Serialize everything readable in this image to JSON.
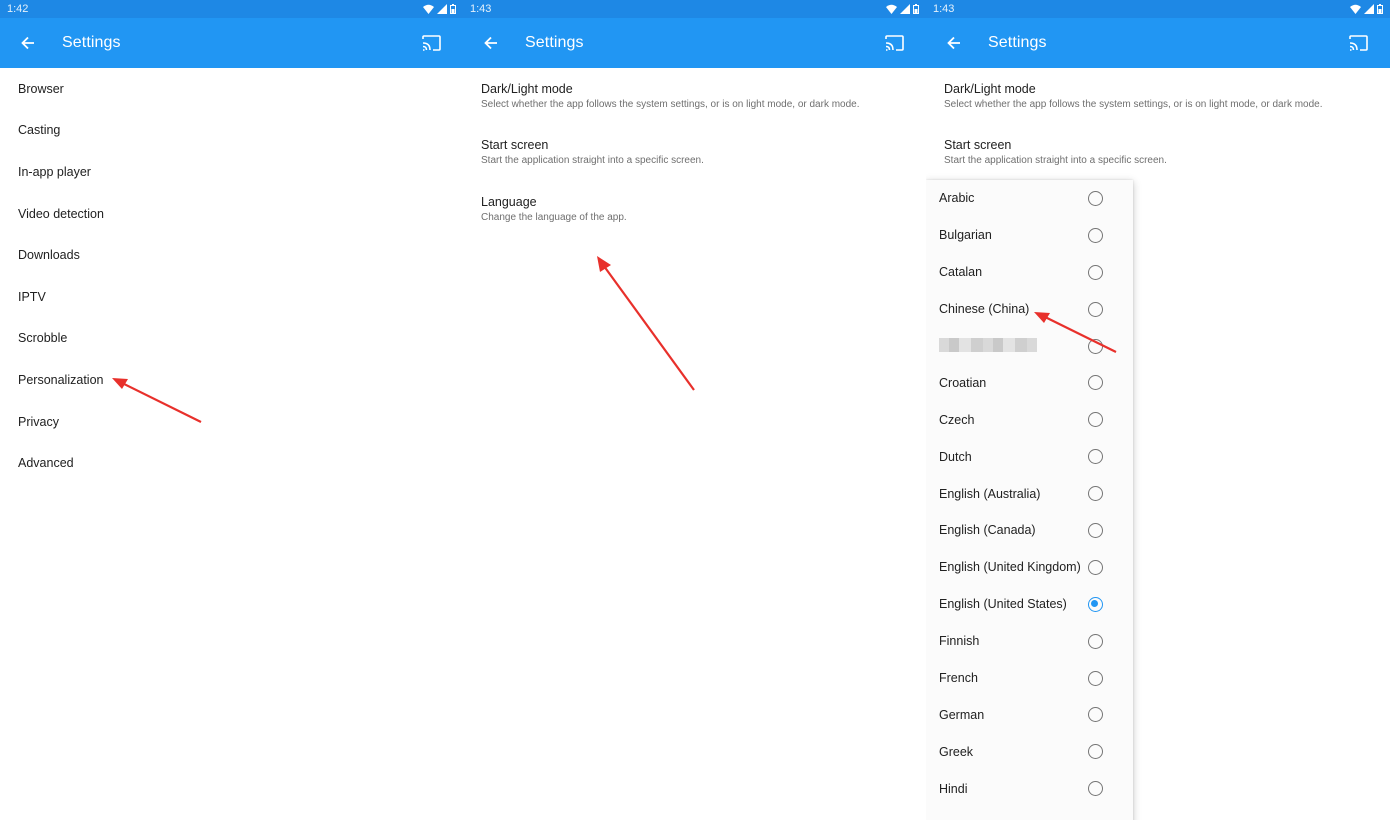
{
  "colors": {
    "status_bar": "#1e88e5",
    "app_bar": "#2196f3",
    "accent": "#2196f3",
    "annotation_arrow": "#e8302b"
  },
  "panels": [
    {
      "status_time": "1:42",
      "title": "Settings",
      "menu_items": [
        "Browser",
        "Casting",
        "In-app player",
        "Video detection",
        "Downloads",
        "IPTV",
        "Scrobble",
        "Personalization",
        "Privacy",
        "Advanced"
      ]
    },
    {
      "status_time": "1:43",
      "title": "Settings",
      "prefs": [
        {
          "title": "Dark/Light mode",
          "summary": "Select whether the app follows the system settings, or is on light mode, or dark mode."
        },
        {
          "title": "Start screen",
          "summary": "Start the application straight into a specific screen."
        },
        {
          "title": "Language",
          "summary": "Change the language of the app."
        }
      ]
    },
    {
      "status_time": "1:43",
      "title": "Settings",
      "prefs": [
        {
          "title": "Dark/Light mode",
          "summary": "Select whether the app follows the system settings, or is on light mode, or dark mode."
        },
        {
          "title": "Start screen",
          "summary": "Start the application straight into a specific screen."
        }
      ],
      "languages": [
        {
          "name": "Arabic",
          "selected": false
        },
        {
          "name": "Bulgarian",
          "selected": false
        },
        {
          "name": "Catalan",
          "selected": false
        },
        {
          "name": "Chinese (China)",
          "selected": false
        },
        {
          "name": "",
          "selected": false,
          "blurred": true
        },
        {
          "name": "Croatian",
          "selected": false
        },
        {
          "name": "Czech",
          "selected": false
        },
        {
          "name": "Dutch",
          "selected": false
        },
        {
          "name": "English (Australia)",
          "selected": false
        },
        {
          "name": "English (Canada)",
          "selected": false
        },
        {
          "name": "English (United Kingdom)",
          "selected": false
        },
        {
          "name": "English (United States)",
          "selected": true
        },
        {
          "name": "Finnish",
          "selected": false
        },
        {
          "name": "French",
          "selected": false
        },
        {
          "name": "German",
          "selected": false
        },
        {
          "name": "Greek",
          "selected": false
        },
        {
          "name": "Hindi",
          "selected": false
        }
      ]
    }
  ],
  "icons": {
    "back": "arrow-back-icon",
    "cast": "cast-icon",
    "wifi": "wifi-icon",
    "signal": "signal-icon",
    "battery": "battery-icon"
  }
}
